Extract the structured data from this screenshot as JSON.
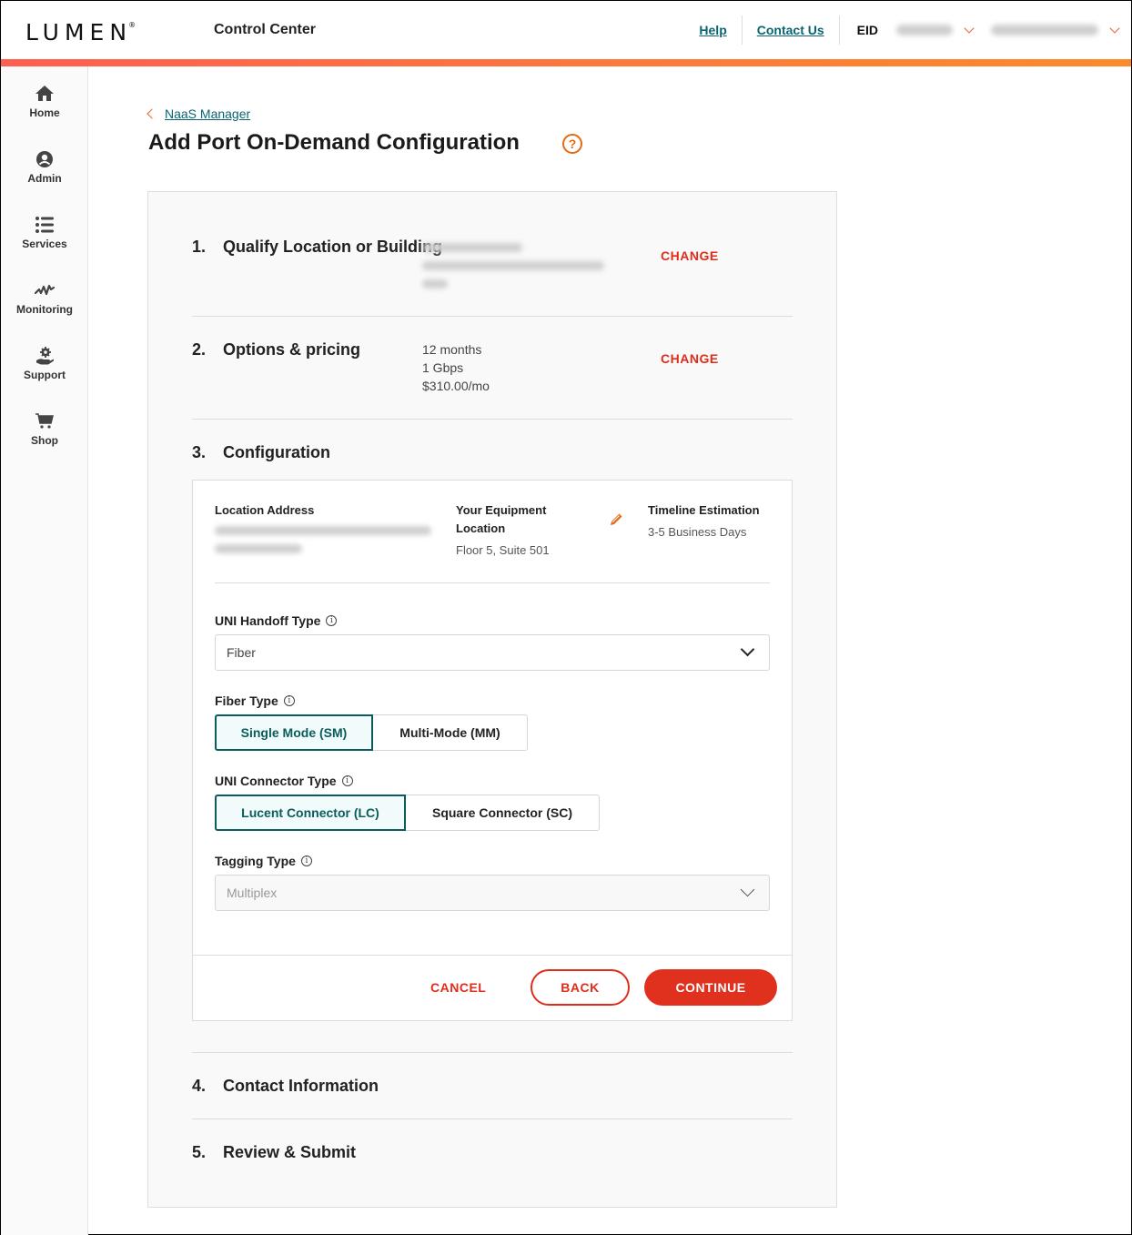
{
  "header": {
    "logo": "LUMEN",
    "app_title": "Control Center",
    "links": [
      {
        "label": "Help"
      },
      {
        "label": "Contact Us"
      }
    ],
    "eid_label": "EID"
  },
  "sidebar": {
    "items": [
      {
        "label": "Home",
        "icon": "home-icon"
      },
      {
        "label": "Admin",
        "icon": "user-icon"
      },
      {
        "label": "Services",
        "icon": "list-icon"
      },
      {
        "label": "Monitoring",
        "icon": "pulse-icon"
      },
      {
        "label": "Support",
        "icon": "support-icon"
      },
      {
        "label": "Shop",
        "icon": "cart-icon"
      }
    ]
  },
  "breadcrumb": {
    "label": "NaaS Manager"
  },
  "page": {
    "title": "Add Port On-Demand Configuration"
  },
  "steps": [
    {
      "num": "1.",
      "title": "Qualify Location or Building",
      "action": "CHANGE"
    },
    {
      "num": "2.",
      "title": "Options & pricing",
      "summary": [
        "12 months",
        "1 Gbps",
        "$310.00/mo"
      ],
      "action": "CHANGE"
    },
    {
      "num": "3.",
      "title": "Configuration"
    },
    {
      "num": "4.",
      "title": "Contact Information"
    },
    {
      "num": "5.",
      "title": "Review & Submit"
    }
  ],
  "configuration": {
    "location_address_label": "Location Address",
    "equipment_label": "Your Equipment Location",
    "equipment_value": "Floor 5, Suite 501",
    "timeline_label": "Timeline Estimation",
    "timeline_value": "3-5 Business Days",
    "uni_handoff": {
      "label": "UNI Handoff Type",
      "value": "Fiber"
    },
    "fiber_type": {
      "label": "Fiber Type",
      "options": [
        "Single Mode (SM)",
        "Multi-Mode (MM)"
      ],
      "selected": "Single Mode (SM)"
    },
    "uni_connector": {
      "label": "UNI Connector Type",
      "options": [
        "Lucent Connector (LC)",
        "Square Connector (SC)"
      ],
      "selected": "Lucent Connector (LC)"
    },
    "tagging_type": {
      "label": "Tagging Type",
      "value": "Multiplex"
    },
    "buttons": {
      "cancel": "CANCEL",
      "back": "BACK",
      "continue": "CONTINUE"
    }
  },
  "colors": {
    "accent_red": "#e02d1b",
    "teal_link": "#0a6472",
    "selected_teal": "#0b5c5c",
    "orange_icon": "#e56a14"
  }
}
